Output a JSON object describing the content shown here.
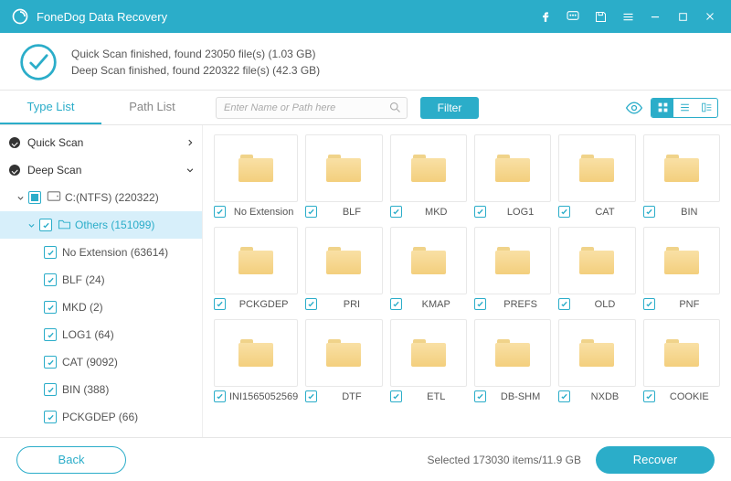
{
  "app": {
    "title": "FoneDog Data Recovery"
  },
  "status": {
    "line1": "Quick Scan finished, found 23050 file(s) (1.03 GB)",
    "line2": "Deep Scan finished, found 220322 file(s) (42.3 GB)"
  },
  "tabs": {
    "type_list": "Type List",
    "path_list": "Path List"
  },
  "search": {
    "placeholder": "Enter Name or Path here"
  },
  "filter_label": "Filter",
  "sidebar": {
    "quick_scan": "Quick Scan",
    "deep_scan": "Deep Scan",
    "drive": "C:(NTFS) (220322)",
    "others": "Others (151099)",
    "items": [
      {
        "label": "No Extension (63614)"
      },
      {
        "label": "BLF (24)"
      },
      {
        "label": "MKD (2)"
      },
      {
        "label": "LOG1 (64)"
      },
      {
        "label": "CAT (9092)"
      },
      {
        "label": "BIN (388)"
      },
      {
        "label": "PCKGDEP (66)"
      }
    ]
  },
  "grid": [
    {
      "name": "No Extension"
    },
    {
      "name": "BLF"
    },
    {
      "name": "MKD"
    },
    {
      "name": "LOG1"
    },
    {
      "name": "CAT"
    },
    {
      "name": "BIN"
    },
    {
      "name": "PCKGDEP"
    },
    {
      "name": "PRI"
    },
    {
      "name": "KMAP"
    },
    {
      "name": "PREFS"
    },
    {
      "name": "OLD"
    },
    {
      "name": "PNF"
    },
    {
      "name": "INI1565052569"
    },
    {
      "name": "DTF"
    },
    {
      "name": "ETL"
    },
    {
      "name": "DB-SHM"
    },
    {
      "name": "NXDB"
    },
    {
      "name": "COOKIE"
    }
  ],
  "footer": {
    "back": "Back",
    "selected": "Selected 173030 items/11.9 GB",
    "recover": "Recover"
  }
}
